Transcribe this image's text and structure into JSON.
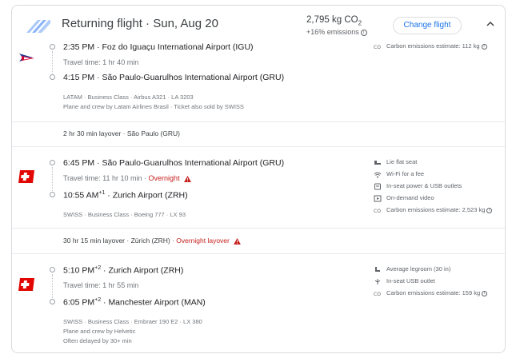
{
  "header": {
    "title": "Returning flight · Sun, Aug 20",
    "co2_value": "2,795 kg CO",
    "co2_sub": "2",
    "emissions_delta": "+16% emissions",
    "change_button": "Change flight"
  },
  "segments": [
    {
      "airline": "LATAM",
      "depart_time": "2:35 PM",
      "depart_sup": "",
      "depart_airport": "Foz do Iguaçu International Airport (IGU)",
      "travel_time": "Travel time: 1 hr 40 min",
      "overnight": "",
      "arrive_time": "4:15 PM",
      "arrive_sup": "",
      "arrive_airport": "São Paulo-Guarulhos International Airport (GRU)",
      "meta_line1": "LATAM · Business Class · Airbus A321 · LA 3203",
      "meta_line2": "Plane and crew by Latam Airlines Brasil · Ticket also sold by SWISS",
      "meta_line3": "",
      "amenities": [
        {
          "icon": "co2-icon",
          "label": "Carbon emissions estimate: 112 kg"
        }
      ]
    },
    {
      "airline": "SWISS",
      "depart_time": "6:45 PM",
      "depart_sup": "",
      "depart_airport": "São Paulo-Guarulhos International Airport (GRU)",
      "travel_time": "Travel time: 11 hr 10 min",
      "overnight": "Overnight",
      "arrive_time": "10:55 AM",
      "arrive_sup": "+1",
      "arrive_airport": "Zurich Airport (ZRH)",
      "meta_line1": "SWISS · Business Class · Boeing 777 · LX 93",
      "meta_line2": "",
      "meta_line3": "",
      "amenities": [
        {
          "icon": "lie-flat-seat-icon",
          "label": "Lie flat seat"
        },
        {
          "icon": "wifi-icon",
          "label": "Wi-Fi for a fee"
        },
        {
          "icon": "power-outlet-icon",
          "label": "In-seat power & USB outlets"
        },
        {
          "icon": "video-icon",
          "label": "On-demand video"
        },
        {
          "icon": "co2-icon",
          "label": "Carbon emissions estimate: 2,523 kg"
        }
      ]
    },
    {
      "airline": "SWISS",
      "depart_time": "5:10 PM",
      "depart_sup": "+2",
      "depart_airport": "Zurich Airport (ZRH)",
      "travel_time": "Travel time: 1 hr 55 min",
      "overnight": "",
      "arrive_time": "6:05 PM",
      "arrive_sup": "+2",
      "arrive_airport": "Manchester Airport (MAN)",
      "meta_line1": "SWISS · Business Class · Embraer 190 E2 · LX 380",
      "meta_line2": "Plane and crew by Helvetic",
      "meta_line3": "Often delayed by 30+ min",
      "amenities": [
        {
          "icon": "legroom-icon",
          "label": "Average legroom (30 in)"
        },
        {
          "icon": "usb-icon",
          "label": "In-seat USB outlet"
        },
        {
          "icon": "co2-icon",
          "label": "Carbon emissions estimate: 159 kg"
        }
      ]
    }
  ],
  "layovers": [
    {
      "text": "2 hr 30 min layover · São Paulo (GRU)",
      "overnight": ""
    },
    {
      "text": "30 hr 15 min layover · Zürich (ZRH) · ",
      "overnight": "Overnight layover"
    }
  ],
  "colors": {
    "accent": "#1a73e8",
    "warning": "#c5221f",
    "latam_blue": "#2b3990",
    "latam_red": "#e4002b",
    "swiss_red": "#e10600"
  }
}
